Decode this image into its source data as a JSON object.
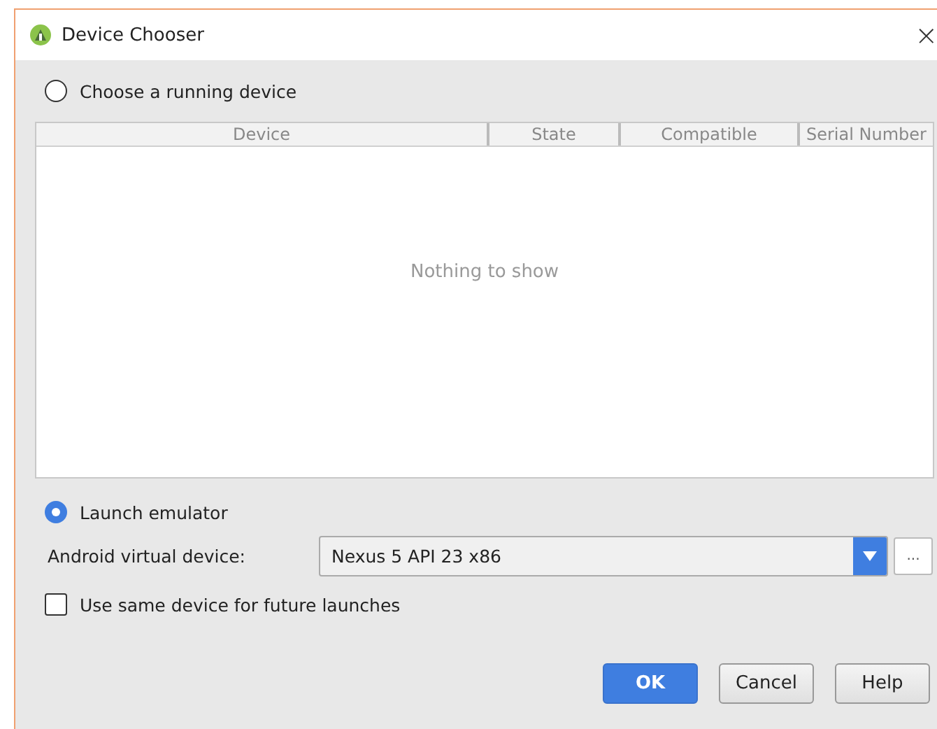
{
  "window": {
    "title": "Device Chooser",
    "close": "×"
  },
  "running": {
    "label": "Choose a running device",
    "selected": false
  },
  "table": {
    "columns": [
      "Device",
      "State",
      "Compatible",
      "Serial Number"
    ],
    "empty_text": "Nothing to show"
  },
  "emulator": {
    "label": "Launch emulator",
    "selected": true,
    "avd_label": "Android virtual device:",
    "avd_value": "Nexus 5 API 23 x86",
    "more": "..."
  },
  "same_device": {
    "label": "Use same device for future launches",
    "checked": false
  },
  "buttons": [
    {
      "label": "OK",
      "primary": true
    },
    {
      "label": "Cancel",
      "primary": false
    },
    {
      "label": "Help",
      "primary": false
    }
  ]
}
